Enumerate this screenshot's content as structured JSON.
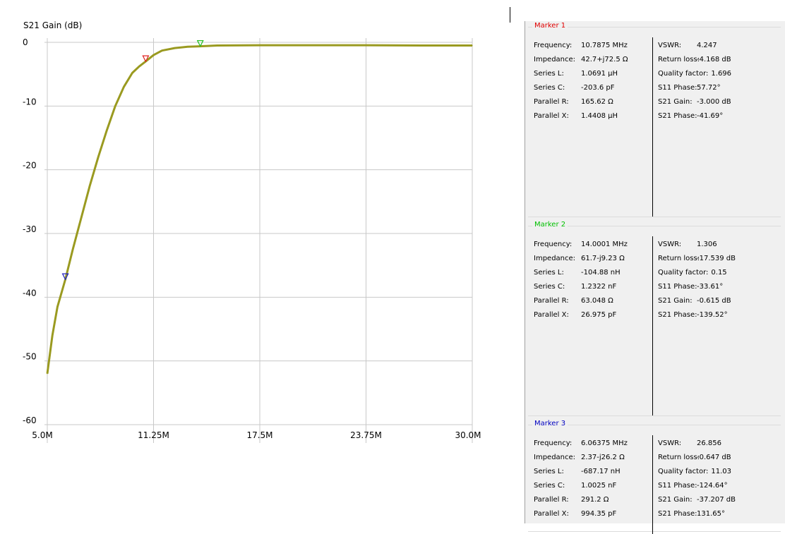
{
  "chart": {
    "title": "S21 Gain (dB)"
  },
  "chart_data": {
    "type": "line",
    "title": "S21 Gain (dB)",
    "xlabel": "",
    "ylabel": "S21 Gain (dB)",
    "xlim": [
      5.0,
      30.0
    ],
    "ylim": [
      -60,
      0
    ],
    "x_ticks": [
      "5.0M",
      "11.25M",
      "17.5M",
      "23.75M",
      "30.0M"
    ],
    "x_tick_values": [
      5.0,
      11.25,
      17.5,
      23.75,
      30.0
    ],
    "y_ticks": [
      "0",
      "-10",
      "-20",
      "-30",
      "-40",
      "-50",
      "-60"
    ],
    "y_tick_values": [
      0,
      -10,
      -20,
      -30,
      -40,
      -50,
      -60
    ],
    "grid": true,
    "series": [
      {
        "color": "#9a9a20",
        "x": [
          5.0,
          5.3,
          5.6,
          6.06375,
          6.5,
          7.0,
          7.5,
          8.0,
          8.5,
          9.0,
          9.5,
          10.0,
          10.4,
          10.7875,
          11.25,
          11.75,
          12.5,
          13.25,
          14.0001,
          15.0,
          17.5,
          20.0,
          23.75,
          27.0,
          30.0
        ],
        "y": [
          -52.0,
          -46.0,
          -41.5,
          -37.2,
          -32.5,
          -27.5,
          -22.5,
          -18.0,
          -13.8,
          -10.0,
          -7.0,
          -4.8,
          -3.8,
          -3.0,
          -2.0,
          -1.3,
          -0.9,
          -0.7,
          -0.615,
          -0.5,
          -0.45,
          -0.45,
          -0.45,
          -0.5,
          -0.5
        ]
      }
    ],
    "markers": [
      {
        "name": "Marker 1",
        "x": 10.7875,
        "y": -3.0,
        "color": "#e02020",
        "direction": "down"
      },
      {
        "name": "Marker 2",
        "x": 14.0001,
        "y": -0.615,
        "color": "#20c020",
        "direction": "down"
      },
      {
        "name": "Marker 3",
        "x": 6.06375,
        "y": -37.207,
        "color": "#2020c0",
        "direction": "down"
      }
    ]
  },
  "panel": {
    "markers": [
      {
        "title": "Marker 1",
        "title_color": "#e00000",
        "left": [
          {
            "label": "Frequency:",
            "value": "10.7875 MHz"
          },
          {
            "label": "Impedance:",
            "value": "42.7+j72.5 Ω"
          },
          {
            "label": "Series L:",
            "value": "1.0691 μH"
          },
          {
            "label": "Series C:",
            "value": "-203.6 pF"
          },
          {
            "label": "Parallel R:",
            "value": "165.62 Ω"
          },
          {
            "label": "Parallel X:",
            "value": "1.4408 μH"
          }
        ],
        "right": [
          {
            "label": "VSWR:",
            "value": "4.247"
          },
          {
            "label": "Return loss:",
            "value": "-4.168 dB"
          },
          {
            "label": "Quality factor:",
            "value": "1.696"
          },
          {
            "label": "S11 Phase:",
            "value": "57.72°"
          },
          {
            "label": "S21 Gain:",
            "value": "-3.000 dB"
          },
          {
            "label": "S21 Phase:",
            "value": "-41.69°"
          }
        ]
      },
      {
        "title": "Marker 2",
        "title_color": "#00c000",
        "left": [
          {
            "label": "Frequency:",
            "value": "14.0001 MHz"
          },
          {
            "label": "Impedance:",
            "value": "61.7-j9.23 Ω"
          },
          {
            "label": "Series L:",
            "value": "-104.88 nH"
          },
          {
            "label": "Series C:",
            "value": "1.2322 nF"
          },
          {
            "label": "Parallel R:",
            "value": "63.048 Ω"
          },
          {
            "label": "Parallel X:",
            "value": "26.975 pF"
          }
        ],
        "right": [
          {
            "label": "VSWR:",
            "value": "1.306"
          },
          {
            "label": "Return loss:",
            "value": "-17.539 dB"
          },
          {
            "label": "Quality factor:",
            "value": "0.15"
          },
          {
            "label": "S11 Phase:",
            "value": "-33.61°"
          },
          {
            "label": "S21 Gain:",
            "value": "-0.615 dB"
          },
          {
            "label": "S21 Phase:",
            "value": "-139.52°"
          }
        ]
      },
      {
        "title": "Marker 3",
        "title_color": "#0000c0",
        "left": [
          {
            "label": "Frequency:",
            "value": "6.06375 MHz"
          },
          {
            "label": "Impedance:",
            "value": "2.37-j26.2 Ω"
          },
          {
            "label": "Series L:",
            "value": "-687.17 nH"
          },
          {
            "label": "Series C:",
            "value": "1.0025 nF"
          },
          {
            "label": "Parallel R:",
            "value": "291.2 Ω"
          },
          {
            "label": "Parallel X:",
            "value": "994.35 pF"
          }
        ],
        "right": [
          {
            "label": "VSWR:",
            "value": "26.856"
          },
          {
            "label": "Return loss:",
            "value": "-0.647 dB"
          },
          {
            "label": "Quality factor:",
            "value": "11.03"
          },
          {
            "label": "S11 Phase:",
            "value": "-124.64°"
          },
          {
            "label": "S21 Gain:",
            "value": "-37.207 dB"
          },
          {
            "label": "S21 Phase:",
            "value": "131.65°"
          }
        ]
      }
    ]
  }
}
